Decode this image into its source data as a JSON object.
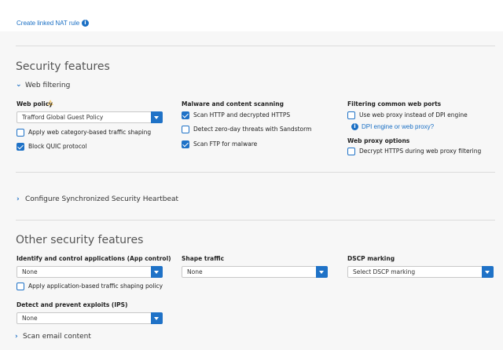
{
  "nat_link": "Create linked NAT rule",
  "security": {
    "title": "Security features",
    "web_filtering": "Web filtering",
    "web_policy": {
      "label": "Web policy",
      "value": "Trafford Global Guest Policy",
      "apply_traffic_shaping": "Apply web category-based traffic shaping",
      "block_quic": "Block QUIC protocol"
    },
    "malware": {
      "label": "Malware and content scanning",
      "scan_http": "Scan HTTP and decrypted HTTPS",
      "detect_zero_day": "Detect zero-day threats with Sandstorm",
      "scan_ftp": "Scan FTP for malware"
    },
    "filtering_ports": {
      "label": "Filtering common web ports",
      "use_proxy": "Use web proxy instead of DPI engine",
      "dpi_link": "DPI engine or web proxy?"
    },
    "proxy_options": {
      "label": "Web proxy options",
      "decrypt": "Decrypt HTTPS during web proxy filtering"
    }
  },
  "heartbeat": "Configure Synchronized Security Heartbeat",
  "other": {
    "title": "Other security features",
    "app_control": {
      "label": "Identify and control applications (App control)",
      "value": "None",
      "apply_shaping": "Apply application-based traffic shaping policy"
    },
    "shape_traffic": {
      "label": "Shape traffic",
      "value": "None"
    },
    "dscp": {
      "label": "DSCP marking",
      "value": "Select DSCP marking"
    },
    "ips": {
      "label": "Detect and prevent exploits (IPS)",
      "value": "None"
    },
    "scan_email": "Scan email content"
  },
  "checkbox_states": {
    "apply_traffic_shaping": false,
    "block_quic": true,
    "scan_http": true,
    "detect_zero_day": false,
    "scan_ftp": true,
    "use_proxy": false,
    "decrypt": false,
    "apply_app_shaping": false
  },
  "colors": {
    "accent": "#1f72c7",
    "link": "#1a6fc4",
    "warning": "#f0a500",
    "background": "#f7f7f7"
  },
  "icons": {
    "info": "info-icon",
    "warning": "warning-icon",
    "chevron_down": "chevron-down-icon",
    "chevron_right": "chevron-right-icon",
    "dropdown": "dropdown-arrow-icon"
  }
}
